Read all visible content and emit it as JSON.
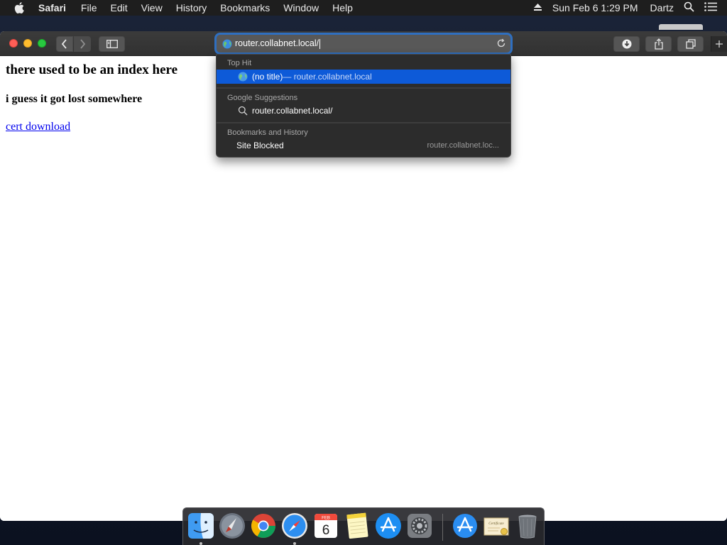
{
  "menubar": {
    "app_name": "Safari",
    "items": [
      "File",
      "Edit",
      "View",
      "History",
      "Bookmarks",
      "Window",
      "Help"
    ],
    "clock": "Sun Feb 6  1:29 PM",
    "user": "Dartz",
    "icons": [
      "apple-icon",
      "eject-icon",
      "spotlight-search-icon",
      "notification-center-icon"
    ]
  },
  "toolbar": {
    "url": "router.collabnet.local/",
    "icons": [
      "back-icon",
      "forward-icon",
      "sidebar-icon",
      "globe-icon",
      "reload-icon",
      "download-icon",
      "share-icon",
      "tabs-overview-icon",
      "new-tab-icon"
    ]
  },
  "page": {
    "heading": "there used to be an index here",
    "subheading": "i guess it got lost somewhere",
    "link": "cert download"
  },
  "dropdown": {
    "top_hit": {
      "section": "Top Hit",
      "title": "(no title)",
      "subtitle": " — router.collabnet.local"
    },
    "google": {
      "section": "Google Suggestions",
      "suggestion": "router.collabnet.local/"
    },
    "bookmarks": {
      "section": "Bookmarks and History",
      "title": "Site Blocked",
      "url": "router.collabnet.loc..."
    }
  },
  "dock": {
    "apps": [
      "Finder",
      "Launchpad",
      "Google Chrome",
      "Safari",
      "Calendar",
      "Notes",
      "App Store",
      "System Preferences",
      "Applications",
      "Certificate",
      "Trash"
    ],
    "calendar": {
      "month": "FEB",
      "day": "6"
    }
  },
  "colors": {
    "selection": "#0d5ad8",
    "focus_ring": "#2f6fc0",
    "link": "#0000ee"
  }
}
